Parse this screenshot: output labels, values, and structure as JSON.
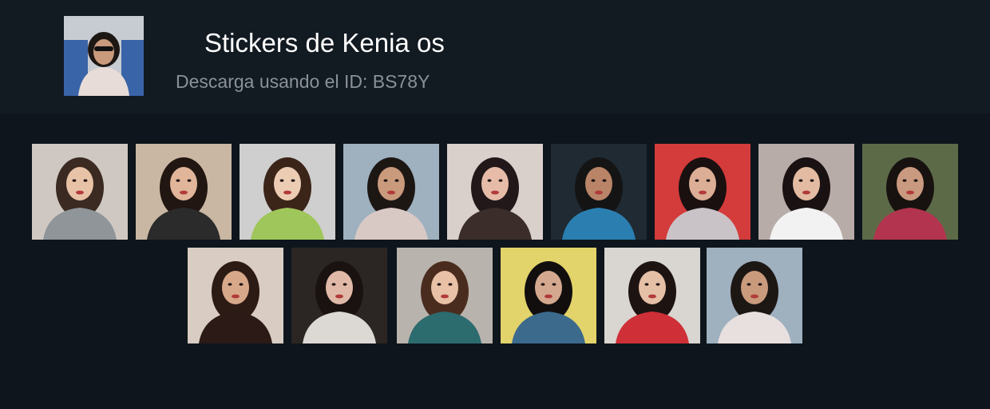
{
  "header": {
    "title": "Stickers de Kenia os",
    "subtitle": "Descarga usando el ID: BS78Y",
    "thumb_icon": "portrait-photo-icon"
  },
  "stickers": [
    {
      "icon": "portrait-photo-icon",
      "bg": "#cfc8c2",
      "hair": "#3a2a22",
      "skin": "#e8c2a6",
      "top": "#8f9599"
    },
    {
      "icon": "portrait-photo-icon",
      "bg": "#c9b7a3",
      "hair": "#221612",
      "skin": "#e0b599",
      "top": "#2b2b2b"
    },
    {
      "icon": "portrait-photo-icon",
      "bg": "#cfcfcf",
      "hair": "#3b2418",
      "skin": "#eccdb4",
      "top": "#9fc65a"
    },
    {
      "icon": "portrait-photo-icon",
      "bg": "#9fb0bf",
      "hair": "#1d1714",
      "skin": "#c99a7c",
      "top": "#d9c9c4"
    },
    {
      "icon": "portrait-photo-icon",
      "bg": "#d9cfcb",
      "hair": "#22181a",
      "skin": "#e6bca8",
      "top": "#3a2d2a"
    },
    {
      "icon": "portrait-photo-icon",
      "bg": "#1f2a33",
      "hair": "#141414",
      "skin": "#b98468",
      "top": "#2a7fb0"
    },
    {
      "icon": "portrait-photo-icon",
      "bg": "#d43b3b",
      "hair": "#1b1010",
      "skin": "#dcae96",
      "top": "#c9c3c8"
    },
    {
      "icon": "portrait-photo-icon",
      "bg": "#b8aca8",
      "hair": "#1a1212",
      "skin": "#e2bba2",
      "top": "#f2f2f2"
    },
    {
      "icon": "portrait-photo-icon",
      "bg": "#5d6a48",
      "hair": "#17120f",
      "skin": "#c99980",
      "top": "#b3344e"
    },
    {
      "icon": "portrait-photo-icon",
      "bg": "#d8ccc3",
      "hair": "#2c1a14",
      "skin": "#d7a889",
      "top": "#2b1a16"
    },
    {
      "icon": "portrait-photo-icon",
      "bg": "#2b2624",
      "hair": "#1a1210",
      "skin": "#e0b9a8",
      "top": "#dcd8d4"
    },
    {
      "icon": "portrait-photo-icon",
      "bg": "#b9b3ad",
      "hair": "#4a2c1e",
      "skin": "#e9c1a6",
      "top": "#2c6b6e"
    },
    {
      "icon": "portrait-photo-icon",
      "bg": "#e2d36a",
      "hair": "#120e0e",
      "skin": "#d3a88e",
      "top": "#3b6a8c"
    },
    {
      "icon": "portrait-photo-icon",
      "bg": "#d9d5d0",
      "hair": "#1d1412",
      "skin": "#e5bfa6",
      "top": "#cf2f37"
    },
    {
      "icon": "portrait-photo-icon",
      "bg": "#9fb0bf",
      "hair": "#1d1714",
      "skin": "#c99a7c",
      "top": "#e8e0de"
    }
  ]
}
